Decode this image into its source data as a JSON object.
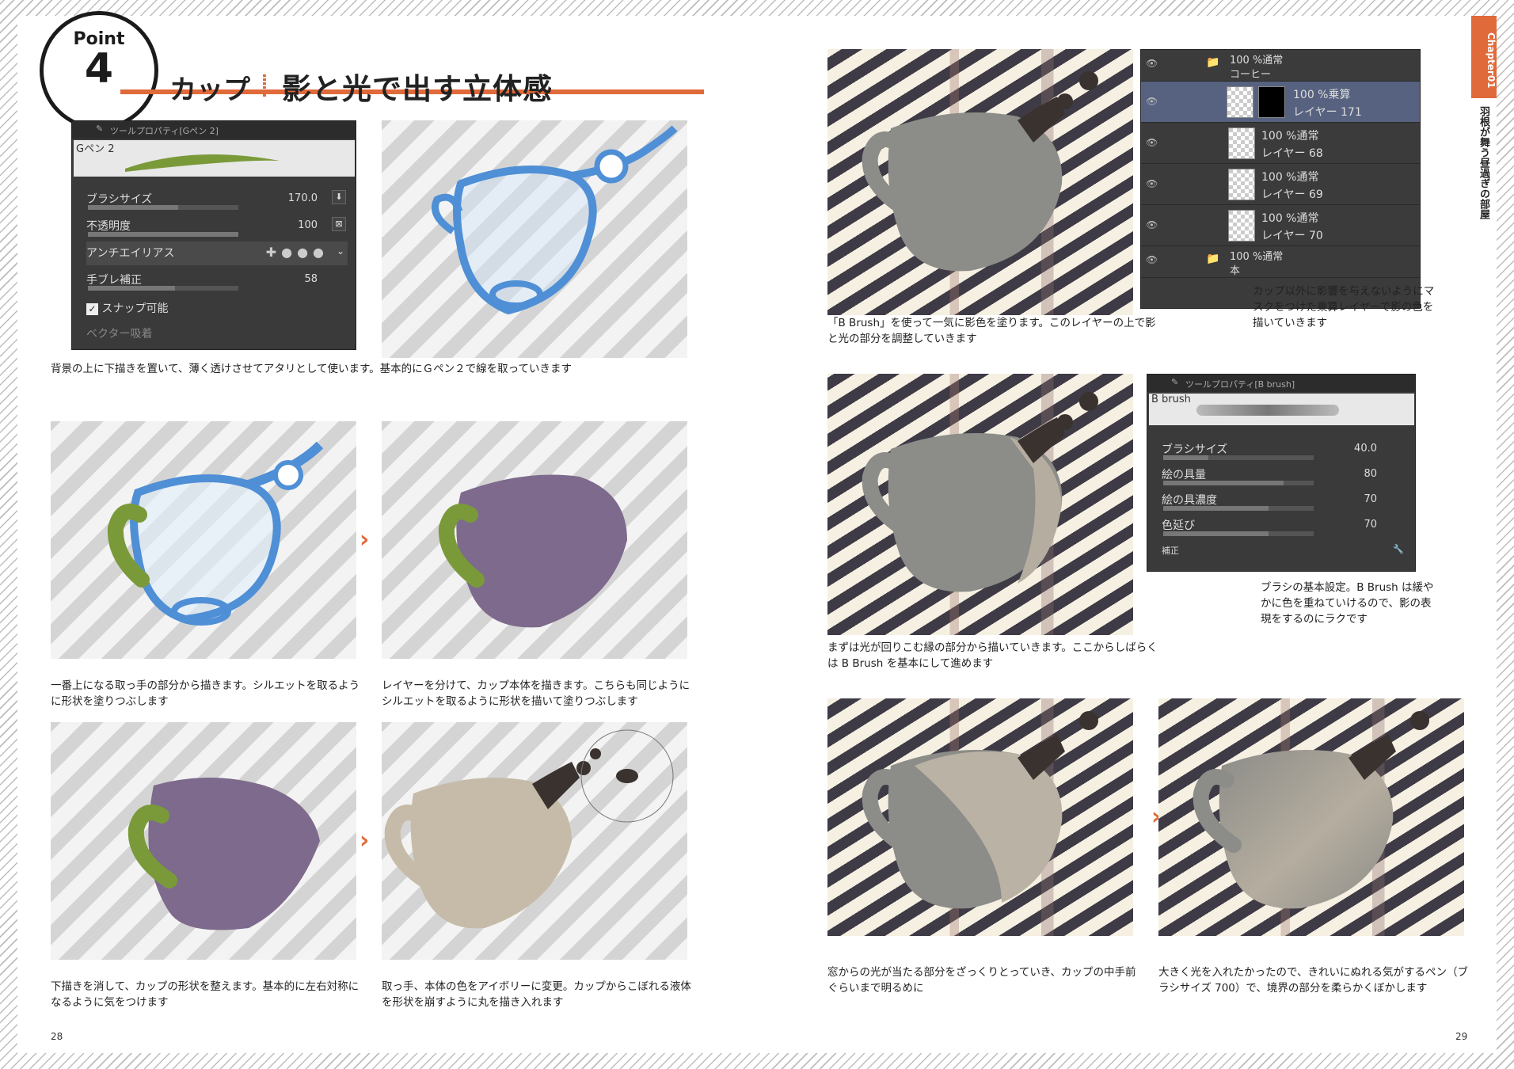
{
  "header": {
    "point_word": "Point",
    "point_number": "4",
    "subtitle": "カップ",
    "title": "影と光で出す立体感"
  },
  "tool_property_gpen": {
    "window_title": "ツールプロパティ[Gペン 2]",
    "brush_name": "Gペン 2",
    "rows": [
      {
        "label": "ブラシサイズ",
        "value": "170.0"
      },
      {
        "label": "不透明度",
        "value": "100"
      },
      {
        "label": "アンチエイリアス",
        "value": ""
      },
      {
        "label": "手ブレ補正",
        "value": "58"
      }
    ],
    "snap_label": "スナップ可能",
    "vector_label": "ベクター吸着"
  },
  "captions": {
    "c1": "背景の上に下描きを置いて、薄く透けさせてアタリとして使います。基本的にＧペン２で線を取っていきます",
    "c2": "一番上になる取っ手の部分から描きます。シルエットを取るように形状を塗りつぶします",
    "c3": "レイヤーを分けて、カップ本体を描きます。こちらも同じようにシルエットを取るように形状を描いて塗りつぶします",
    "c4": "下描きを消して、カップの形状を整えます。基本的に左右対称になるように気をつけます",
    "c5": "取っ手、本体の色をアイボリーに変更。カップからこぼれる液体を形状を崩すように丸を描き入れます",
    "c6": "「B Brush」を使って一気に影色を塗ります。このレイヤーの上で影と光の部分を調整していきます",
    "c7": "カップ以外に影響を与えないようにマスクをつけた乗算レイヤーで影の色を描いていきます",
    "c8": "まずは光が回りこむ縁の部分から描いていきます。ここからしばらくは B Brush を基本にして進めます",
    "c9": "ブラシの基本設定。B Brush は緩やかに色を重ねていけるので、影の表現をするのにラクです",
    "c10": "窓からの光が当たる部分をざっくりとっていき、カップの中手前ぐらいまで明るめに",
    "c11": "大きく光を入れたかったので、きれいにぬれる気がするペン（ブラシサイズ 700）で、境界の部分を柔らかくぼかします"
  },
  "layers": [
    {
      "t1": "100 %通常",
      "t2": "コーヒー",
      "folder": true
    },
    {
      "t1": "100 %乗算",
      "t2": "レイヤー 171",
      "selected": true
    },
    {
      "t1": "100 %通常",
      "t2": "レイヤー 68"
    },
    {
      "t1": "100 %通常",
      "t2": "レイヤー 69"
    },
    {
      "t1": "100 %通常",
      "t2": "レイヤー 70"
    },
    {
      "t1": "100 %通常",
      "t2": "本",
      "folder": true
    }
  ],
  "tool_property_bbrush": {
    "window_title": "ツールプロパティ[B brush]",
    "brush_name": "B brush",
    "rows": [
      {
        "label": "ブラシサイズ",
        "value": "40.0"
      },
      {
        "label": "絵の具量",
        "value": "80"
      },
      {
        "label": "絵の具濃度",
        "value": "70"
      },
      {
        "label": "色延び",
        "value": "70"
      }
    ],
    "bottom_label": "補正"
  },
  "chapter": {
    "tab": "Chapter01",
    "title": "羽根が舞う昼過ぎの部屋"
  },
  "page_numbers": {
    "left": "28",
    "right": "29"
  },
  "colors": {
    "accent": "#e06a3a",
    "sketch_blue": "#4f8fd6",
    "handle_green": "#7a9a3a",
    "purple": "#7d6a8c",
    "ivory": "#c6bba9",
    "grey_cup": "#8c8c88"
  }
}
